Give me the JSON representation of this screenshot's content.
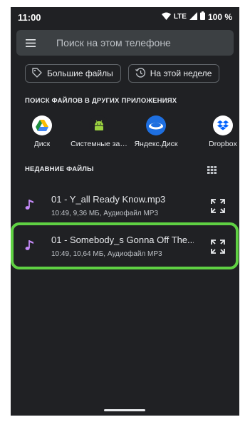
{
  "status_bar": {
    "time": "11:00",
    "network": "LTE",
    "battery": "100 %"
  },
  "search": {
    "placeholder": "Поиск на этом телефоне",
    "menu_icon": "hamburger-menu-icon"
  },
  "chips": [
    {
      "label": "Большие файлы",
      "icon": "tag-icon"
    },
    {
      "label": "На этой неделе",
      "icon": "history-icon"
    }
  ],
  "apps_section": {
    "title": "ПОИСК ФАЙЛОВ В ДРУГИХ ПРИЛОЖЕНИЯХ",
    "apps": [
      {
        "label": "Диск",
        "icon": "google-drive-icon"
      },
      {
        "label": "Системные за…",
        "icon": "android-icon"
      },
      {
        "label": "Яндекс.Диск",
        "icon": "yandex-disk-icon"
      },
      {
        "label": "Dropbox",
        "icon": "dropbox-icon"
      }
    ]
  },
  "recent_section": {
    "title": "НЕДАВНИЕ ФАЙЛЫ",
    "view_toggle_icon": "grid-view-icon",
    "files": [
      {
        "name": "01 - Y_all Ready Know.mp3",
        "meta": "10:49, 9,36 МБ, Аудиофайл MP3",
        "icon": "music-note-icon"
      },
      {
        "name": "01 - Somebody_s Gonna Off The...",
        "meta": "10:49, 10,64 МБ, Аудиофайл MP3",
        "icon": "music-note-icon",
        "highlighted": true
      }
    ]
  },
  "colors": {
    "background": "#202124",
    "surface": "#3c4043",
    "text": "#e8eaed",
    "secondary_text": "#bdc1c6",
    "audio_icon": "#c58af9",
    "highlight": "#5fd143"
  }
}
